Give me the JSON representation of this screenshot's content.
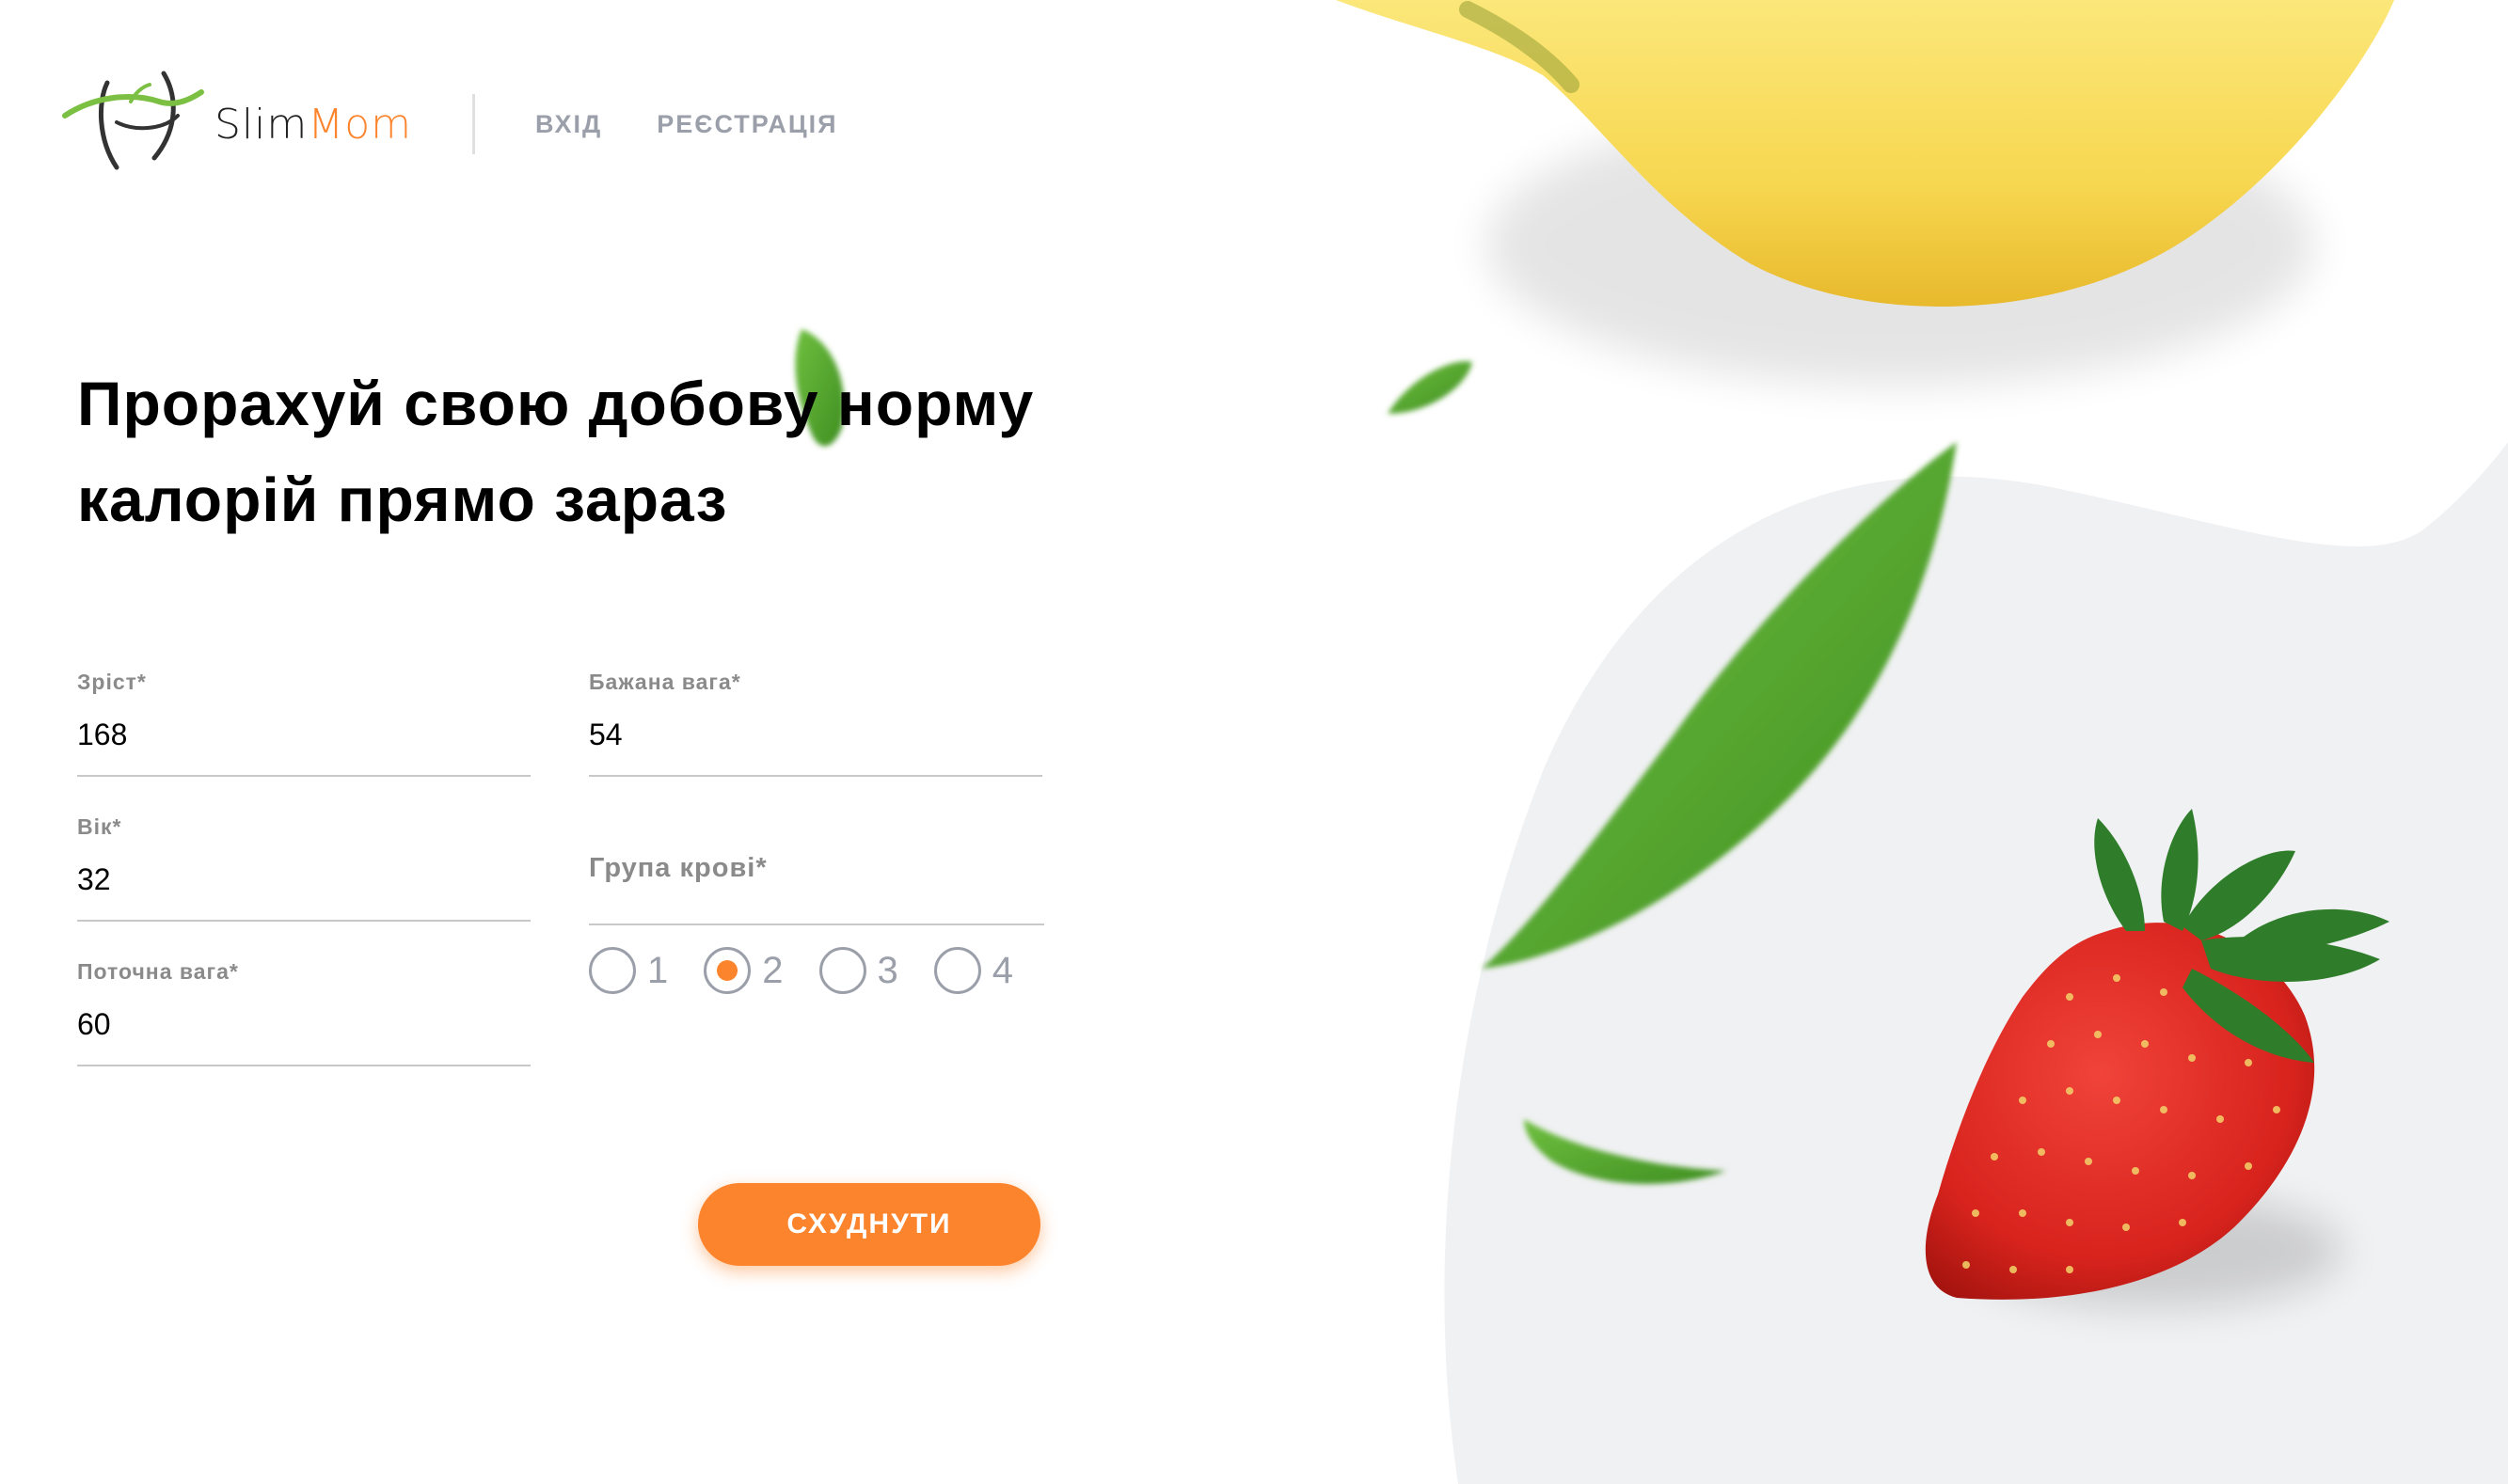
{
  "brand": {
    "name_slim": "Slim",
    "name_mom": "Mom",
    "accent_color": "#fc842d"
  },
  "nav": {
    "login": "ВХІД",
    "register": "РЕЄСТРАЦІЯ"
  },
  "hero": {
    "title": "Прорахуй свою добову норму калорій прямо зараз"
  },
  "form": {
    "height_label": "Зріст*",
    "height_value": "168",
    "age_label": "Вік*",
    "age_value": "32",
    "current_weight_label": "Поточна вага*",
    "current_weight_value": "60",
    "desired_weight_label": "Бажана вага*",
    "desired_weight_value": "54",
    "blood_group_label": "Група крові*",
    "blood_groups": [
      "1",
      "2",
      "3",
      "4"
    ],
    "blood_group_selected": "2",
    "submit_label": "СХУДНУТИ"
  }
}
